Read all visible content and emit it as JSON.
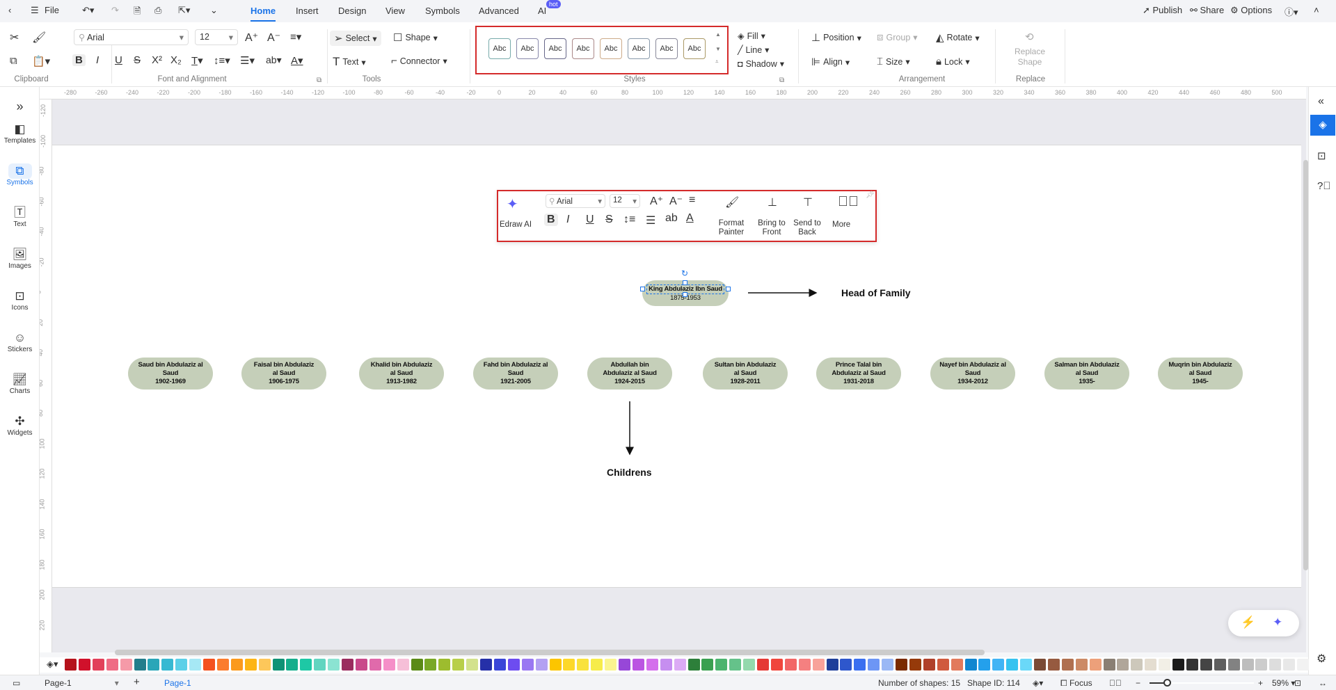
{
  "topbar": {
    "file": "File",
    "tabs": [
      "Home",
      "Insert",
      "Design",
      "View",
      "Symbols",
      "Advanced",
      "AI"
    ],
    "active_tab": "Home",
    "hot_badge": "hot",
    "publish": "Publish",
    "share": "Share",
    "options": "Options"
  },
  "ribbon": {
    "groups": {
      "clipboard": "Clipboard",
      "font": "Font and Alignment",
      "tools": "Tools",
      "styles": "Styles",
      "arrangement": "Arrangement",
      "replace": "Replace"
    },
    "font_name": "Arial",
    "font_size": "12",
    "select": "Select",
    "shape": "Shape",
    "text": "Text",
    "connector": "Connector",
    "style_samples": [
      "Abc",
      "Abc",
      "Abc",
      "Abc",
      "Abc",
      "Abc",
      "Abc",
      "Abc"
    ],
    "fill": "Fill",
    "line": "Line",
    "shadow": "Shadow",
    "position": "Position",
    "group": "Group",
    "rotate": "Rotate",
    "align": "Align",
    "size": "Size",
    "lock": "Lock",
    "replace_shape": "Replace Shape"
  },
  "sidebar": {
    "items": [
      {
        "label": "Templates",
        "icon": "templates-icon"
      },
      {
        "label": "Symbols",
        "icon": "symbols-icon",
        "active": true
      },
      {
        "label": "Text",
        "icon": "text-icon"
      },
      {
        "label": "Images",
        "icon": "images-icon"
      },
      {
        "label": "Icons",
        "icon": "icons-icon"
      },
      {
        "label": "Stickers",
        "icon": "stickers-icon"
      },
      {
        "label": "Charts",
        "icon": "charts-icon"
      },
      {
        "label": "Widgets",
        "icon": "widgets-icon"
      }
    ]
  },
  "ruler": {
    "h": [
      "-280",
      "-260",
      "-240",
      "-220",
      "-200",
      "-180",
      "-160",
      "-140",
      "-120",
      "-100",
      "-80",
      "-60",
      "-40",
      "-20",
      "0",
      "20",
      "40",
      "60",
      "80",
      "100",
      "120",
      "140",
      "160",
      "180",
      "200",
      "220",
      "240",
      "260",
      "280",
      "300",
      "320",
      "340",
      "360",
      "380",
      "400",
      "420",
      "440",
      "460",
      "480",
      "500"
    ],
    "v": [
      "-120",
      "-100",
      "-80",
      "-60",
      "-40",
      "-20",
      "0",
      "20",
      "40",
      "60",
      "80",
      "100",
      "120",
      "140",
      "160",
      "180",
      "200",
      "220"
    ]
  },
  "floating_toolbar": {
    "edraw_ai": "Edraw AI",
    "font_name": "Arial",
    "font_size": "12",
    "format_painter": "Format Painter",
    "bring_to_front": "Bring to Front",
    "send_to_back": "Send to Back",
    "more": "More"
  },
  "diagram": {
    "head": {
      "name": "King Abdulaziz Ibn Saud",
      "years": "1875-1953"
    },
    "head_label": "Head of Family",
    "children_label": "Childrens",
    "children": [
      {
        "name": "Saud bin Abdulaziz al Saud",
        "years": "1902-1969"
      },
      {
        "name": "Faisal bin Abdulaziz al Saud",
        "years": "1906-1975"
      },
      {
        "name": "Khalid bin Abdulaziz al Saud",
        "years": "1913-1982"
      },
      {
        "name": "Fahd bin Abdulaziz al Saud",
        "years": "1921-2005"
      },
      {
        "name": "Abdullah bin Abdulaziz al Saud",
        "years": "1924-2015"
      },
      {
        "name": "Sultan bin Abdulaziz al Saud",
        "years": "1928-2011"
      },
      {
        "name": "Prince Talal bin Abdulaziz al Saud",
        "years": "1931-2018"
      },
      {
        "name": "Nayef bin Abdulaziz al Saud",
        "years": "1934-2012"
      },
      {
        "name": "Salman bin Abdulaziz al Saud",
        "years": "1935-"
      },
      {
        "name": "Muqrin bin Abdulaziz al Saud",
        "years": "1945-"
      }
    ],
    "node_fill": "#c5cfb9"
  },
  "palette": [
    "#b5121b",
    "#d0112b",
    "#e2405a",
    "#ef6b84",
    "#f59aa8",
    "#237e8c",
    "#2aa6b8",
    "#37b9d2",
    "#5bd0e8",
    "#a6e8f5",
    "#f4511e",
    "#fb7c2d",
    "#fb9a1c",
    "#fdb515",
    "#fdc75a",
    "#0f9275",
    "#15ae8c",
    "#1ec8a5",
    "#62d5c0",
    "#8be3d2",
    "#9b2c5e",
    "#c9488a",
    "#e06aab",
    "#f58fc8",
    "#f6bfd8",
    "#5a8a16",
    "#79a826",
    "#9dbc2e",
    "#b8cf4a",
    "#d3e28c",
    "#2530a8",
    "#3a46d8",
    "#6d4cf0",
    "#9a78f2",
    "#b3a1f2",
    "#fcc500",
    "#fdd82a",
    "#f9e23c",
    "#f6ec4a",
    "#faf590",
    "#9747d8",
    "#bb55e2",
    "#d46fec",
    "#c68ef0",
    "#dcabf5",
    "#2d7f3a",
    "#3aa050",
    "#4bb46e",
    "#65c28a",
    "#94d9ad",
    "#e53935",
    "#f0463c",
    "#f26666",
    "#f58080",
    "#f8a29a",
    "#1e3f9a",
    "#2e57cc",
    "#3a6ff0",
    "#6d96f5",
    "#9ab8f5",
    "#7a2a00",
    "#963a0a",
    "#b0402a",
    "#d05a3e",
    "#e27a5c",
    "#1186d0",
    "#24a0ec",
    "#41b4f5",
    "#36c3f0",
    "#6ad8f8",
    "#7a4a35",
    "#965a40",
    "#b07050",
    "#cc8a66",
    "#eda07a",
    "#8a7f74",
    "#b0a69a",
    "#cdc8bb",
    "#e4ddd0",
    "#f2efe6",
    "#1b1b1b",
    "#333333",
    "#454545",
    "#5e5e5e",
    "#828282",
    "#bdbdbd",
    "#cccccc",
    "#dddddd",
    "#e8e8e8",
    "#f2f2f2"
  ],
  "status": {
    "page_select": "Page-1",
    "page_tab": "Page-1",
    "shapes": "Number of shapes: 15",
    "shape_id": "Shape ID: 114",
    "focus": "Focus",
    "zoom": "59%",
    "zoom_level": 59
  }
}
